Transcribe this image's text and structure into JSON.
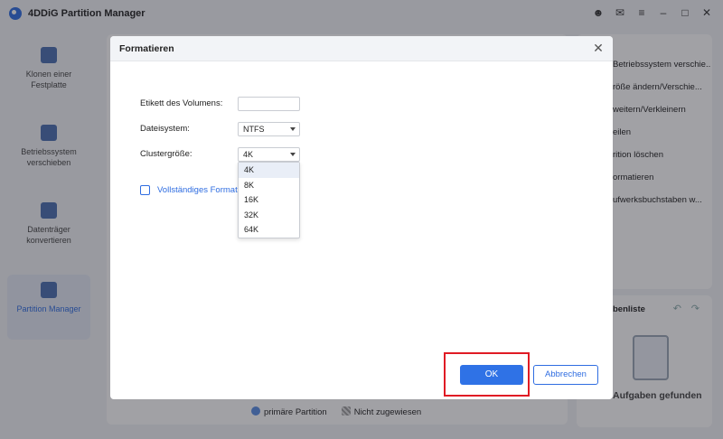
{
  "app": {
    "title": "4DDiG Partition Manager"
  },
  "sidebar": {
    "items": [
      {
        "label": "Klonen einer Festplatte"
      },
      {
        "label": "Betriebssystem verschieben"
      },
      {
        "label": "Datenträger konvertieren"
      },
      {
        "label": "Partition Manager"
      }
    ]
  },
  "right_panel": {
    "items": [
      {
        "label": "Betriebssystem verschie..."
      },
      {
        "label": "röße ändern/Verschie..."
      },
      {
        "label": "weitern/Verkleinern"
      },
      {
        "label": "eilen"
      },
      {
        "label": "rition löschen"
      },
      {
        "label": "ormatieren"
      },
      {
        "label": "ufwerksbuchstaben w..."
      }
    ]
  },
  "task_panel": {
    "title": "benliste",
    "empty": "Aufgaben gefunden"
  },
  "legend": {
    "primary": "primäre Partition",
    "unallocated": "Nicht zugewiesen"
  },
  "dialog": {
    "title": "Formatieren",
    "volume_label": "Etikett des Volumens:",
    "volume_value": "",
    "filesystem_label": "Dateisystem:",
    "filesystem_value": "NTFS",
    "cluster_label": "Clustergröße:",
    "cluster_value": "4K",
    "cluster_options": [
      "4K",
      "8K",
      "16K",
      "32K",
      "64K"
    ],
    "full_format_label": "Vollständiges Format",
    "ok_label": "OK",
    "cancel_label": "Abbrechen"
  },
  "colors": {
    "accent": "#2f72e6",
    "highlight": "#e01b24"
  }
}
